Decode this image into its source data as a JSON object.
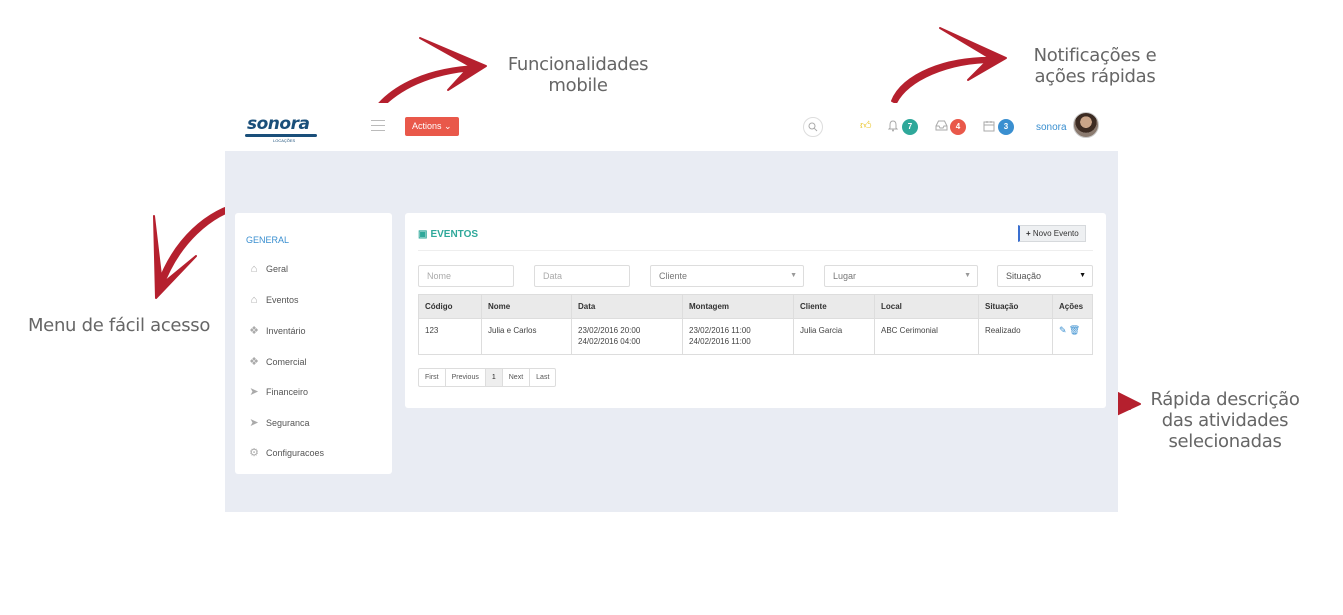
{
  "annotations": {
    "mobile": "Funcionalidades\nmobile",
    "notifications": "Notificações e\nações rápidas",
    "menu": "Menu de fácil acesso",
    "description": "Rápida descrição\ndas atividades\nselecionadas"
  },
  "topbar": {
    "logo_text": "sonora",
    "logo_sub": "LOCAÇÕES",
    "actions_label": "Actions ⌄",
    "notifications": [
      {
        "icon": "bell-icon",
        "count": "7",
        "color": "#2fa89a"
      },
      {
        "icon": "inbox-icon",
        "count": "4",
        "color": "#e9584a"
      },
      {
        "icon": "calendar-icon",
        "count": "3",
        "color": "#3a8fd0"
      }
    ],
    "user_name": "sonora"
  },
  "sidebar": {
    "title": "GENERAL",
    "items": [
      {
        "label": "Geral",
        "icon": "home-icon"
      },
      {
        "label": "Eventos",
        "icon": "home-icon"
      },
      {
        "label": "Inventário",
        "icon": "dropbox-icon"
      },
      {
        "label": "Comercial",
        "icon": "dropbox-icon"
      },
      {
        "label": "Financeiro",
        "icon": "send-icon"
      },
      {
        "label": "Seguranca",
        "icon": "send-icon"
      },
      {
        "label": "Configuracoes",
        "icon": "gear-icon"
      }
    ]
  },
  "panel": {
    "title": "EVENTOS",
    "new_button": "Novo Evento",
    "filters": {
      "nome_placeholder": "Nome",
      "data_placeholder": "Data",
      "cliente": "Cliente",
      "lugar": "Lugar",
      "situacao": "Situação"
    },
    "columns": [
      "Código",
      "Nome",
      "Data",
      "Montagem",
      "Cliente",
      "Local",
      "Situação",
      "Ações"
    ],
    "rows": [
      {
        "codigo": "123",
        "nome": "Julia e Carlos",
        "data1": "23/02/2016 20:00",
        "data2": "24/02/2016 04:00",
        "montagem1": "23/02/2016 11:00",
        "montagem2": "24/02/2016 11:00",
        "cliente": "Julia Garcia",
        "local": "ABC Cerimonial",
        "situacao": "Realizado"
      }
    ],
    "pager": [
      "First",
      "Previous",
      "1",
      "Next",
      "Last"
    ]
  },
  "colors": {
    "accent_red": "#e9584a",
    "accent_teal": "#2fa89a",
    "accent_blue": "#3a8fd0",
    "arrow": "#b5202e"
  }
}
